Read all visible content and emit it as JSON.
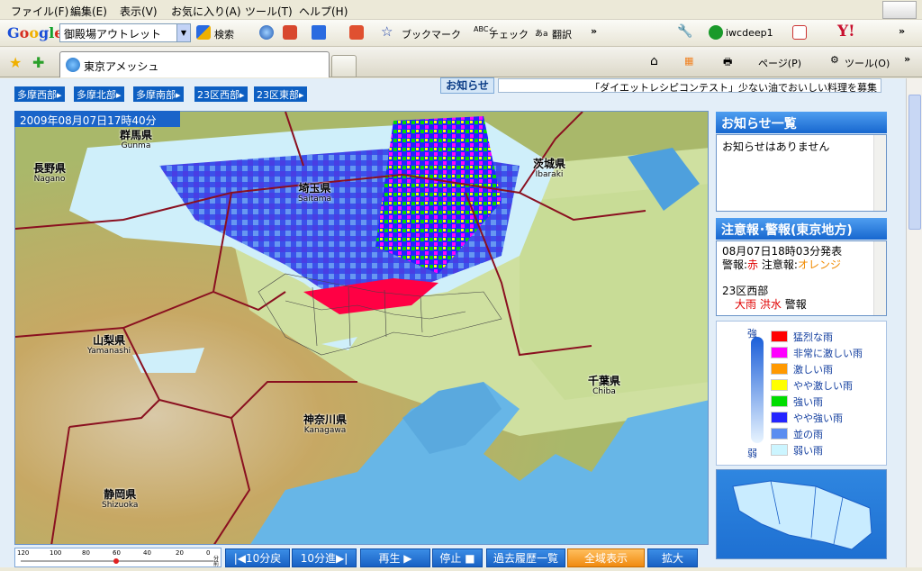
{
  "menu": [
    "ファイル(F)",
    "編集(E)",
    "表示(V)",
    "お気に入り(A)",
    "ツール(T)",
    "ヘルプ(H)"
  ],
  "google_toolbar": {
    "logo": "Google",
    "search_value": "御殿場アウトレット",
    "search_label": "検索",
    "bookmark_label": "ブックマーク",
    "check_label": "チェック",
    "translate_label": "翻訳",
    "user": "iwcdeep1"
  },
  "tab": {
    "title": "東京アメッシュ"
  },
  "command_bar": {
    "page_label": "ページ(P)",
    "tools_label": "ツール(O)"
  },
  "area_tabs": [
    "多摩西部",
    "多摩北部",
    "多摩南部",
    "23区西部",
    "23区東部"
  ],
  "notice_tab": "お知らせ",
  "ticker": "「ダイエットレシピコンテスト」少ない油でおいしい料理を募集",
  "map": {
    "timestamp": "2009年08月07日17時40分",
    "labels": [
      {
        "jp": "群馬県",
        "en": "Gunma"
      },
      {
        "jp": "長野県",
        "en": "Nagano"
      },
      {
        "jp": "埼玉県",
        "en": "Saitama"
      },
      {
        "jp": "茨城県",
        "en": "Ibaraki"
      },
      {
        "jp": "山梨県",
        "en": "Yamanashi"
      },
      {
        "jp": "千葉県",
        "en": "Chiba"
      },
      {
        "jp": "神奈川県",
        "en": "Kanagawa"
      },
      {
        "jp": "静岡県",
        "en": "Shizuoka"
      }
    ]
  },
  "notices": {
    "title": "お知らせ一覧",
    "body": "お知らせはありません"
  },
  "warnings": {
    "title": "注意報･警報(東京地方)",
    "issued": "08月07日18時03分発表",
    "legend_prefix": "警報:",
    "legend_warning": "赤",
    "legend_mid": "注意報:",
    "legend_advisory": "オレンジ",
    "region": "23区西部",
    "item1": "大雨",
    "item2": "洪水",
    "item_suffix": "警報"
  },
  "legend": {
    "strong": "強",
    "weak": "弱",
    "items": [
      {
        "label": "猛烈な雨",
        "color": "#ff0000"
      },
      {
        "label": "非常に激しい雨",
        "color": "#ff00ff"
      },
      {
        "label": "激しい雨",
        "color": "#ff9900"
      },
      {
        "label": "やや激しい雨",
        "color": "#ffff00"
      },
      {
        "label": "強い雨",
        "color": "#00dd00"
      },
      {
        "label": "やや強い雨",
        "color": "#2424ff"
      },
      {
        "label": "並の雨",
        "color": "#5b8df0"
      },
      {
        "label": "弱い雨",
        "color": "#ccf5ff"
      }
    ]
  },
  "timeline": {
    "ticks": [
      "120",
      "100",
      "80",
      "60",
      "40",
      "20",
      "0"
    ],
    "unit": "分前"
  },
  "controls": {
    "back10": "|◀10分戻",
    "fwd10": "10分進▶|",
    "play": "再生 ▶",
    "stop": "停止 ■",
    "history": "過去履歴一覧",
    "fullview": "全域表示",
    "zoom": "拡大"
  }
}
